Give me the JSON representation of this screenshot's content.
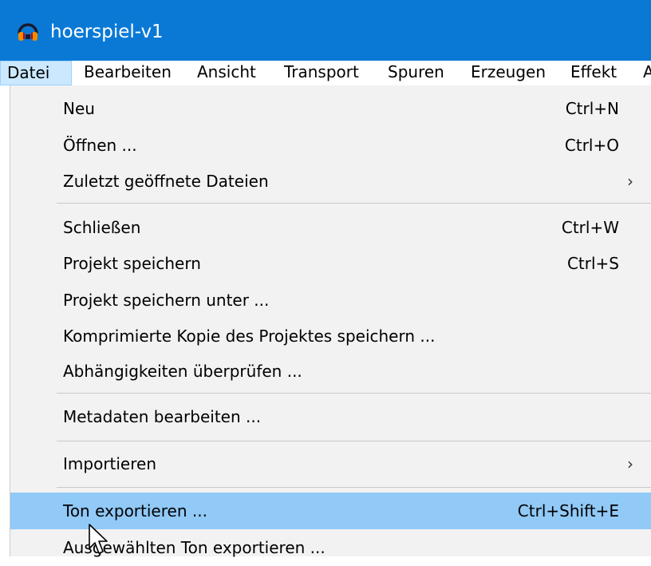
{
  "window": {
    "title": "hoerspiel-v1",
    "app_icon": "audacity-headphones-icon"
  },
  "menubar": {
    "items": [
      {
        "label": "Datei",
        "active": true
      },
      {
        "label": "Bearbeiten"
      },
      {
        "label": "Ansicht"
      },
      {
        "label": "Transport"
      },
      {
        "label": "Spuren"
      },
      {
        "label": "Erzeugen"
      },
      {
        "label": "Effekt"
      },
      {
        "label": "A"
      }
    ]
  },
  "file_menu": {
    "items": [
      {
        "label": "Neu",
        "shortcut": "Ctrl+N"
      },
      {
        "label": "Öffnen ...",
        "shortcut": "Ctrl+O"
      },
      {
        "label": "Zuletzt geöffnete Dateien",
        "submenu": "›"
      },
      {
        "label": "Schließen",
        "shortcut": "Ctrl+W"
      },
      {
        "label": "Projekt speichern",
        "shortcut": "Ctrl+S"
      },
      {
        "label": "Projekt speichern unter ..."
      },
      {
        "label": "Komprimierte Kopie des Projektes speichern ..."
      },
      {
        "label": "Abhängigkeiten überprüfen ..."
      },
      {
        "label": "Metadaten bearbeiten ..."
      },
      {
        "label": "Importieren",
        "submenu": "›"
      },
      {
        "label": "Ton exportieren ...",
        "shortcut": "Ctrl+Shift+E",
        "highlighted": true
      },
      {
        "label": "Ausgewählten Ton exportieren ..."
      }
    ]
  },
  "colors": {
    "titlebar": "#0a79d6",
    "menu_background": "#f2f2f2",
    "highlight": "#91c9f7",
    "active_menubar": "#cce8ff"
  }
}
